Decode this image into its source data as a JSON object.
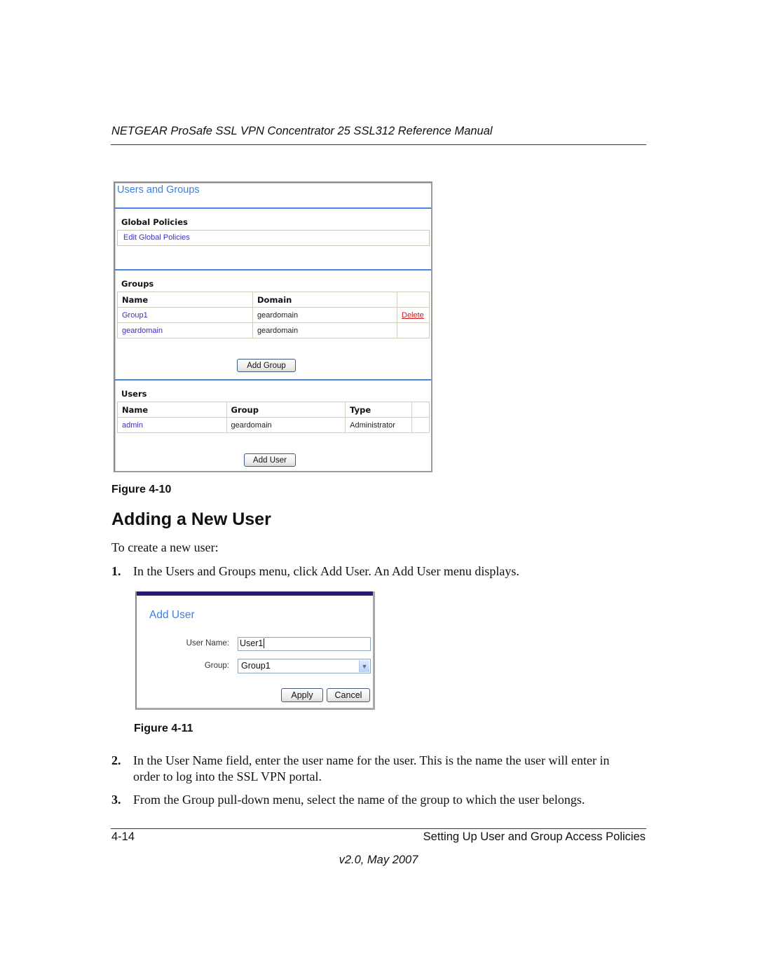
{
  "running_header": "NETGEAR ProSafe SSL VPN Concentrator 25 SSL312 Reference Manual",
  "figure_4_10": {
    "title": "Users and Groups",
    "global_policies": {
      "label": "Global Policies",
      "link": "Edit Global Policies"
    },
    "groups": {
      "label": "Groups",
      "columns": [
        "Name",
        "Domain",
        ""
      ],
      "rows": [
        {
          "name": "Group1",
          "domain": "geardomain",
          "action": "Delete"
        },
        {
          "name": "geardomain",
          "domain": "geardomain",
          "action": ""
        }
      ],
      "add_button": "Add Group"
    },
    "users": {
      "label": "Users",
      "columns": [
        "Name",
        "Group",
        "Type",
        ""
      ],
      "rows": [
        {
          "name": "admin",
          "group": "geardomain",
          "type": "Administrator",
          "action": ""
        }
      ],
      "add_button": "Add User"
    },
    "caption": "Figure 4-10"
  },
  "section": {
    "heading": "Adding a New User",
    "intro": "To create a new user:",
    "steps": [
      {
        "num": "1.",
        "text": "In the Users and Groups menu, click Add User. An Add User menu displays."
      },
      {
        "num": "2.",
        "text_line1": "In the User Name field, enter the user name for the user. This is the name the user will enter in",
        "text_line2": "order to log into the SSL VPN portal."
      },
      {
        "num": "3.",
        "text": "From the Group pull-down menu, select the name of the group to which the user belongs."
      }
    ]
  },
  "figure_4_11": {
    "title": "Add User",
    "user_name_label": "User Name:",
    "user_name_value": "User1",
    "group_label": "Group:",
    "group_selected": "Group1",
    "apply_button": "Apply",
    "cancel_button": "Cancel",
    "caption": "Figure 4-11"
  },
  "footer": {
    "page_number": "4-14",
    "chapter_title": "Setting Up User and Group Access Policies",
    "version": "v2.0, May 2007"
  },
  "colors": {
    "ui_title_blue": "#3d7fe0",
    "link_blue": "#3a2fc0",
    "delete_red": "#d02020",
    "topbar_navy": "#2a1a78"
  }
}
